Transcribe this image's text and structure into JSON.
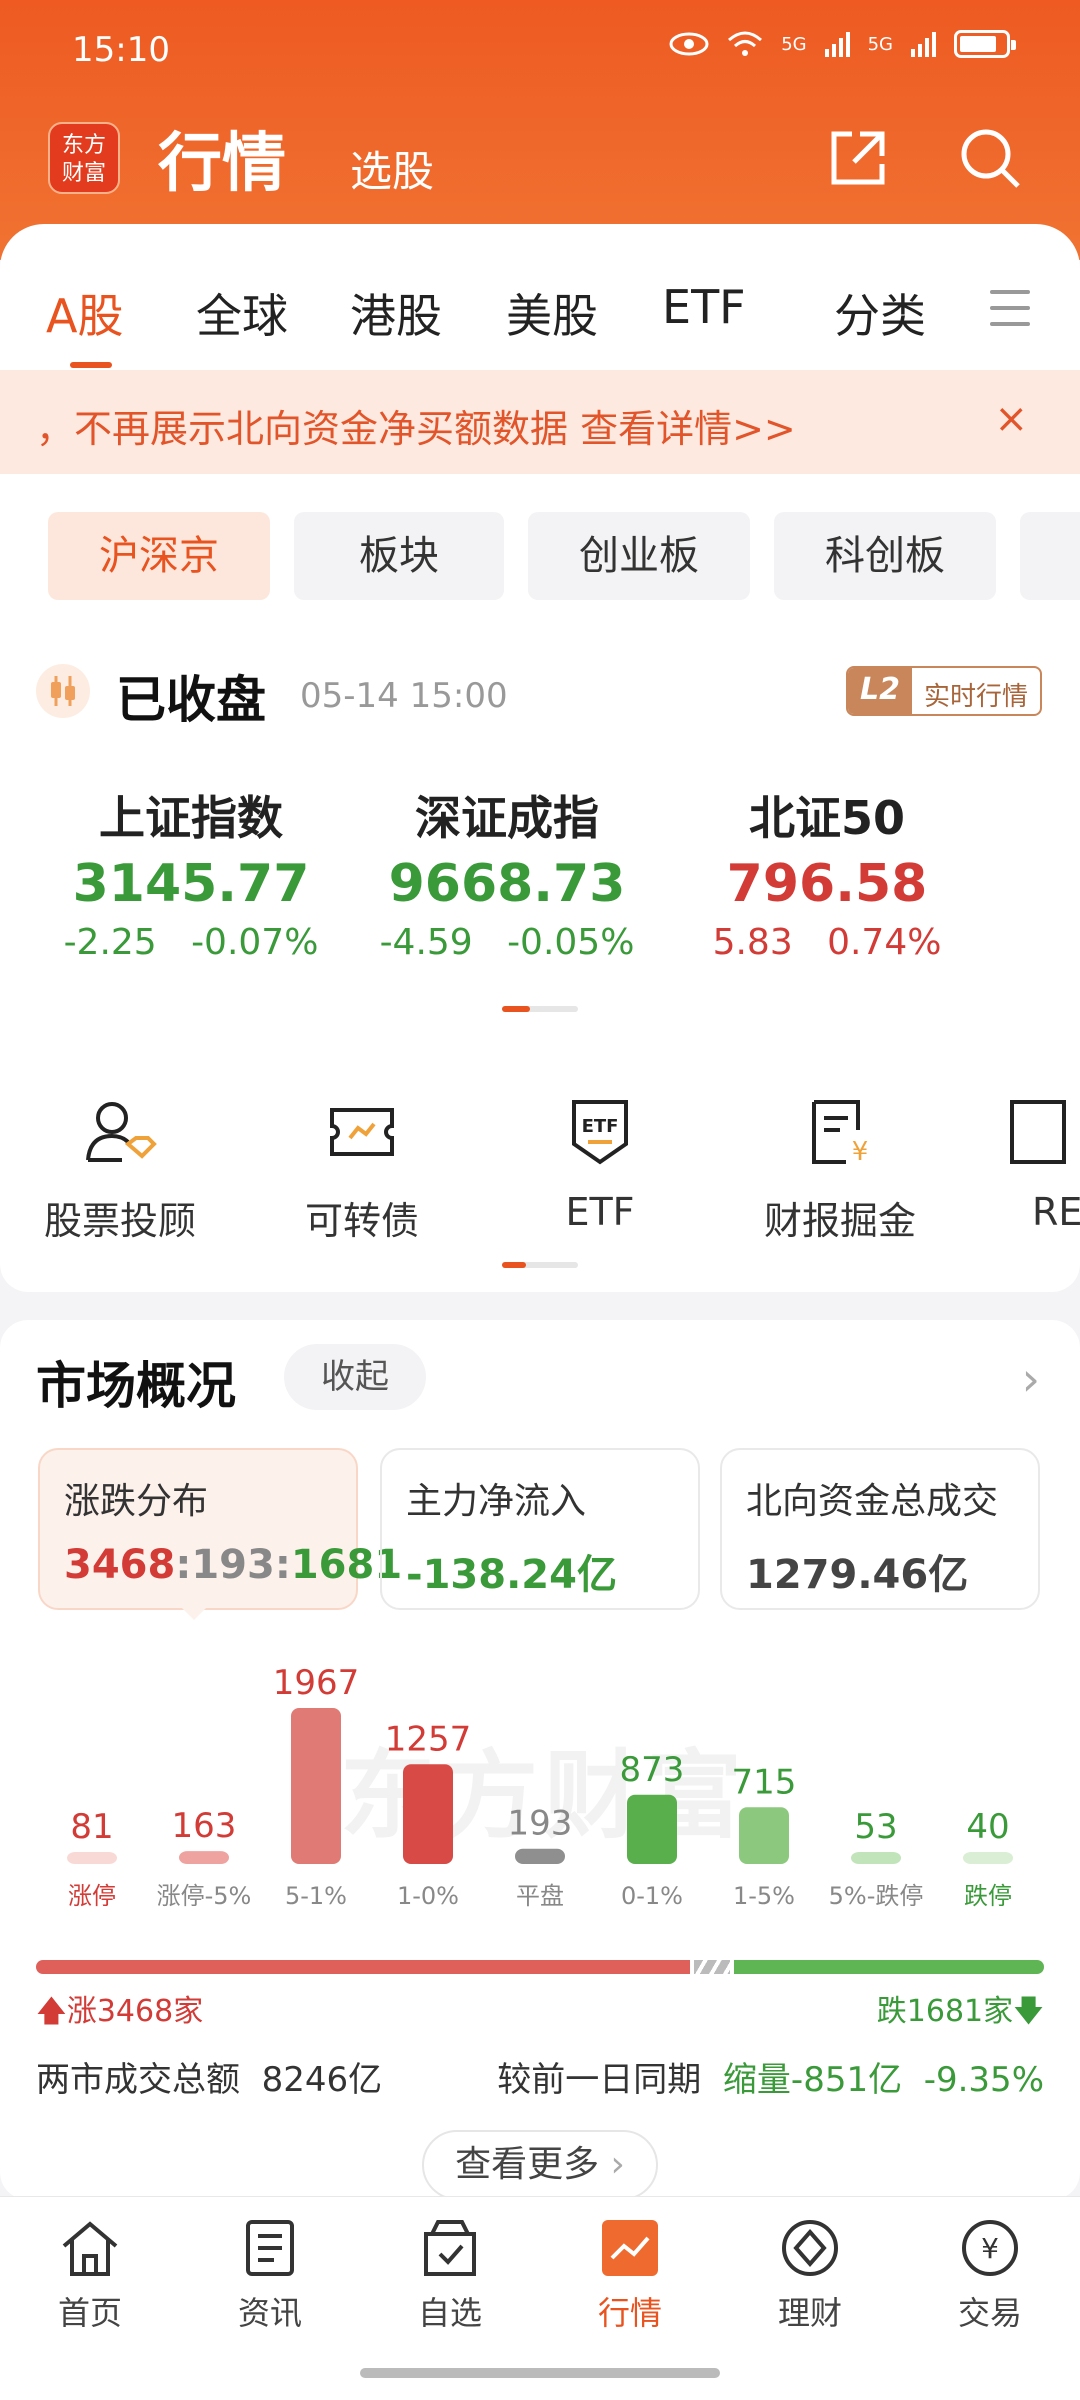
{
  "status_bar": {
    "time": "15:10",
    "net1": "5G",
    "net2": "5G"
  },
  "header": {
    "logo_text": "东方财富",
    "title": "行情",
    "subtitle": "选股"
  },
  "tabs": [
    {
      "label": "A股",
      "active": true
    },
    {
      "label": "全球",
      "active": false
    },
    {
      "label": "港股",
      "active": false
    },
    {
      "label": "美股",
      "active": false
    },
    {
      "label": "ETF",
      "active": false
    },
    {
      "label": "分类",
      "active": false
    }
  ],
  "notice": {
    "text": "，不再展示北向资金净买额数据 查看详情>>",
    "close": "×"
  },
  "chips": [
    {
      "label": "沪深京",
      "active": true
    },
    {
      "label": "板块",
      "active": false
    },
    {
      "label": "创业板",
      "active": false
    },
    {
      "label": "科创板",
      "active": false
    }
  ],
  "market_status": {
    "title": "已收盘",
    "time": "05-14 15:00",
    "badge_l2": "L2",
    "badge_text": "实时行情"
  },
  "indices": [
    {
      "name": "上证指数",
      "price": "3145.77",
      "change": "-2.25",
      "pct": "-0.07%",
      "color": "green"
    },
    {
      "name": "深证成指",
      "price": "9668.73",
      "change": "-4.59",
      "pct": "-0.05%",
      "color": "green"
    },
    {
      "name": "北证50",
      "price": "796.58",
      "change": "5.83",
      "pct": "0.74%",
      "color": "red"
    }
  ],
  "tools": [
    {
      "label": "股票投顾",
      "icon": "advisor-icon"
    },
    {
      "label": "可转债",
      "icon": "bond-icon"
    },
    {
      "label": "ETF",
      "icon": "etf-icon"
    },
    {
      "label": "财报掘金",
      "icon": "report-icon"
    },
    {
      "label": "RE",
      "icon": "reit-icon"
    }
  ],
  "market_overview": {
    "title": "市场概况",
    "collapse": "收起",
    "stats": [
      {
        "title": "涨跌分布",
        "up": "3468",
        "sep1": ":",
        "flat": "193",
        "sep2": ":",
        "down": "1681"
      },
      {
        "title": "主力净流入",
        "value": "-138.24亿"
      },
      {
        "title": "北向资金总成交",
        "value": "1279.46亿"
      }
    ],
    "watermark": "东方财富",
    "rise_label": "涨3468家",
    "fall_label": "跌1681家",
    "turnover_label": "两市成交总额",
    "turnover_value": "8246亿",
    "compare_label": "较前一日同期",
    "compare_value": "缩量-851亿",
    "compare_pct": "-9.35%",
    "more": "查看更多"
  },
  "chart_data": {
    "type": "bar",
    "categories": [
      "涨停",
      "涨停-5%",
      "5-1%",
      "1-0%",
      "平盘",
      "0-1%",
      "1-5%",
      "5%-跌停",
      "跌停"
    ],
    "values": [
      81,
      163,
      1967,
      1257,
      193,
      873,
      715,
      53,
      40
    ],
    "colors": [
      "#f9d9d6",
      "#efa3a0",
      "#e07a74",
      "#d84a45",
      "#8f8f8f",
      "#5aaf4d",
      "#8cc97e",
      "#c2e4ba",
      "#d9eed4"
    ],
    "label_colors": [
      "#d23b36",
      "#d23b36",
      "#d23b36",
      "#d23b36",
      "#888888",
      "#3a9a3a",
      "#3a9a3a",
      "#3a9a3a",
      "#3a9a3a"
    ],
    "category_label_colors": [
      "#d23b36",
      "#888888",
      "#888888",
      "#888888",
      "#888888",
      "#888888",
      "#888888",
      "#888888",
      "#3a9a3a"
    ]
  },
  "ratio": {
    "up": 3468,
    "flat": 193,
    "down": 1681
  },
  "bottom_nav": [
    {
      "label": "首页",
      "icon": "home-icon",
      "active": false
    },
    {
      "label": "资讯",
      "icon": "news-icon",
      "active": false
    },
    {
      "label": "自选",
      "icon": "watchlist-icon",
      "active": false
    },
    {
      "label": "行情",
      "icon": "market-icon",
      "active": true
    },
    {
      "label": "理财",
      "icon": "wealth-icon",
      "active": false
    },
    {
      "label": "交易",
      "icon": "trade-icon",
      "active": false
    }
  ],
  "colors": {
    "brand": "#e8531f",
    "up": "#d23b36",
    "down": "#3a9a3a"
  }
}
